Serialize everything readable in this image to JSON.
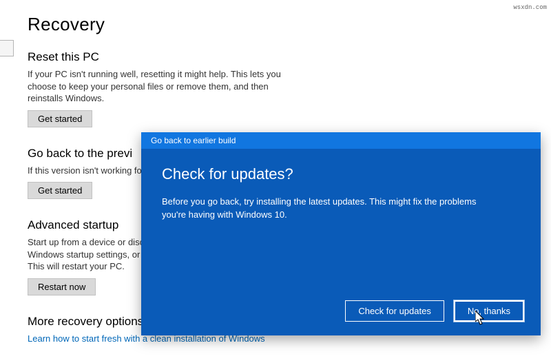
{
  "page": {
    "title": "Recovery"
  },
  "reset": {
    "heading": "Reset this PC",
    "text": "If your PC isn't running well, resetting it might help. This lets you choose to keep your personal files or remove them, and then reinstalls Windows.",
    "button": "Get started"
  },
  "goback": {
    "heading": "Go back to the previ",
    "text": "If this version isn't working for",
    "button": "Get started"
  },
  "advanced": {
    "heading": "Advanced startup",
    "text": "Start up from a device or disc (\nWindows startup settings, or re\nThis will restart your PC.",
    "button": "Restart now"
  },
  "more": {
    "heading": "More recovery options",
    "link": "Learn how to start fresh with a clean installation of Windows"
  },
  "dialog": {
    "titlebar": "Go back to earlier build",
    "heading": "Check for updates?",
    "text": "Before you go back, try installing the latest updates. This might fix the problems you're having with Windows 10.",
    "btn_check": "Check for updates",
    "btn_no": "No, thanks"
  },
  "attribution": "wsxdn.com"
}
